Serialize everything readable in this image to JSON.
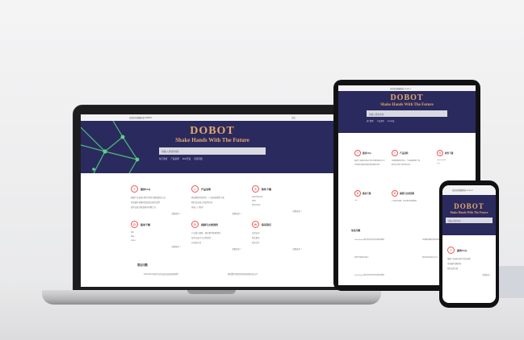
{
  "site": {
    "topbar_text": "欢迎来到越疆科技 DOBOT",
    "lang": "语言",
    "brand": "DOBOT",
    "tagline": "Shake Hands With The Future",
    "search_placeholder": "请输入搜索内容...",
    "hotlinks": [
      "热门搜索",
      "产品说明",
      "SDK开发",
      "常见问题"
    ]
  },
  "cards": [
    {
      "icon": "?",
      "title": "服务FAQ",
      "lines": [
        "越疆产品使用过程中常见问题及解决方法",
        "常见硬件故障排查及售后服务说明",
        "软件安装升级及驱动问题汇总"
      ],
      "more": "查看更多 >"
    },
    {
      "icon": "i",
      "title": "产品说明",
      "lines": [
        "机械臂使用说明书、产品规格参数下载",
        "配件及末端工具说明文档",
        "快速入门指南"
      ],
      "more": "查看更多 >"
    },
    {
      "icon": "S",
      "title": "软件下载",
      "lines": [
        "DobotStudio",
        "SDK",
        "DobotLab"
      ],
      "more": "查看更多 >"
    },
    {
      "icon": "D",
      "title": "驱动下载",
      "lines": [
        "Win",
        "Mac",
        "Linux"
      ],
      "more": "查看更多 >"
    },
    {
      "icon": "D",
      "title": "视频与文档资料",
      "lines": [
        "产品演示视频、操作教学视频资料",
        "技术白皮书与应用案例",
        "开发者文档"
      ],
      "more": "查看更多 >"
    },
    {
      "icon": "W",
      "title": "联系我们",
      "lines": [
        "技术支持",
        "售后服务",
        "商务合作"
      ],
      "more": "查看更多 >"
    }
  ],
  "faq_section": {
    "title": "常见问题",
    "rows": [
      "DobotStudio软件如何安装及连接机械臂?",
      "机械臂回零失败的原因及解决办法?",
      "如何升级固件版本?",
      "驱动安装失败怎么办?"
    ]
  },
  "phone_card": {
    "icon": "?",
    "title": "服务FAQ",
    "lines": [
      "越疆产品使用过程中常见问题",
      "常见硬件故障排查",
      "软件安装升级"
    ],
    "more": "查看更多 >"
  }
}
